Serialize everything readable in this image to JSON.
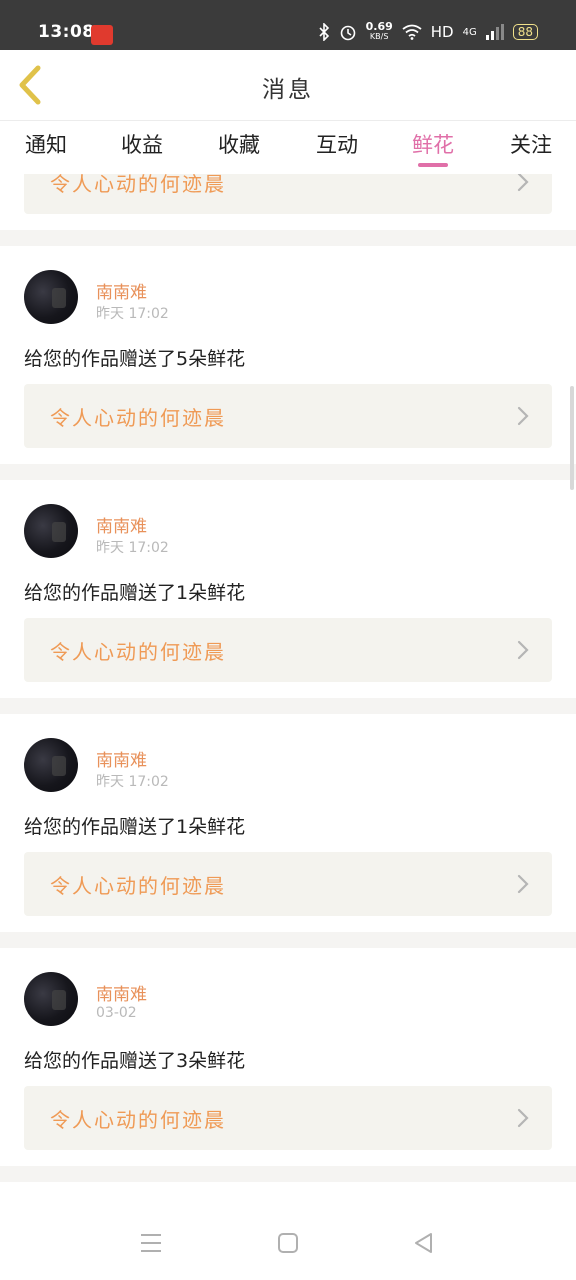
{
  "status": {
    "time": "13:08",
    "net_speed": "0.69",
    "net_unit": "KB/S",
    "hd": "HD",
    "signal": "4G",
    "battery": "88"
  },
  "header": {
    "title": "消息"
  },
  "tabs": [
    {
      "label": "通知"
    },
    {
      "label": "收益"
    },
    {
      "label": "收藏"
    },
    {
      "label": "互动"
    },
    {
      "label": "鲜花"
    },
    {
      "label": "关注"
    }
  ],
  "active_tab": "鲜花",
  "partial_top_card": {
    "work_title": "令人心动的何迹晨"
  },
  "messages": [
    {
      "name": "南南难",
      "time": "昨天 17:02",
      "text": "给您的作品赠送了5朵鲜花",
      "work_title": "令人心动的何迹晨"
    },
    {
      "name": "南南难",
      "time": "昨天 17:02",
      "text": "给您的作品赠送了1朵鲜花",
      "work_title": "令人心动的何迹晨"
    },
    {
      "name": "南南难",
      "time": "昨天 17:02",
      "text": "给您的作品赠送了1朵鲜花",
      "work_title": "令人心动的何迹晨"
    },
    {
      "name": "南南难",
      "time": "03-02",
      "text": "给您的作品赠送了3朵鲜花",
      "work_title": "令人心动的何迹晨"
    }
  ],
  "colors": {
    "accent": "#e06fa8",
    "name": "#e8915a",
    "work_title": "#ef9a55",
    "back_icon": "#e0c24a"
  },
  "icons": {
    "back": "chevron-left-icon",
    "row_chevron": "chevron-right-icon",
    "nav": [
      "menu-icon",
      "home-square-icon",
      "back-triangle-icon"
    ]
  }
}
